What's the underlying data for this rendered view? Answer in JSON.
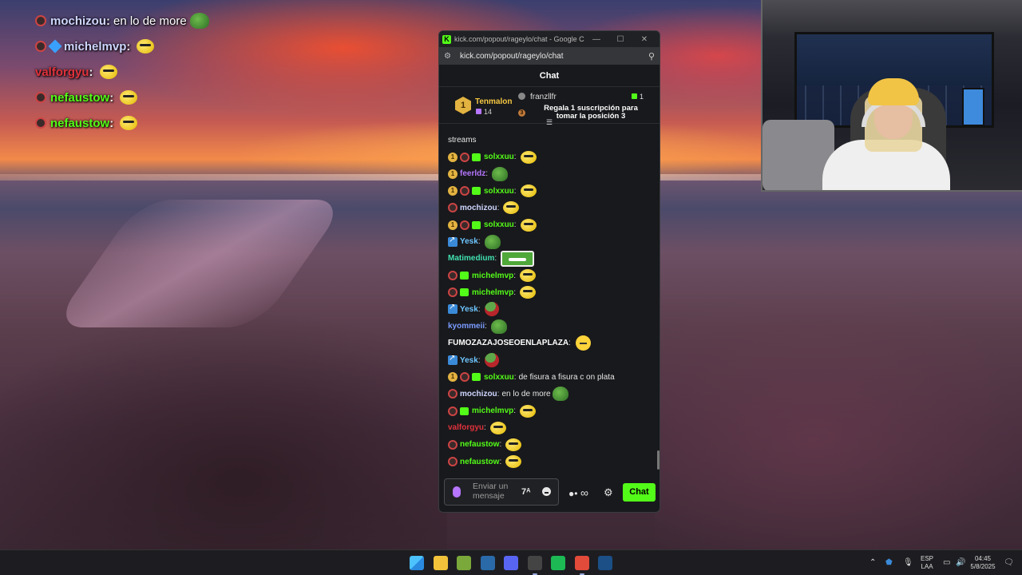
{
  "overlay_chat": [
    {
      "user": "mochizou",
      "color": "#cfd6ff",
      "badges": [
        "mod"
      ],
      "text": "en lo de more",
      "emote": "frog"
    },
    {
      "user": "michelmvp",
      "color": "#cfd6ff",
      "badges": [
        "mod",
        "cube"
      ],
      "text": "",
      "emote": "face"
    },
    {
      "user": "valforgyu",
      "color": "#e0323c",
      "badges": [],
      "text": "",
      "emote": "face"
    },
    {
      "user": "nefaustow",
      "color": "#53fc18",
      "badges": [
        "mod"
      ],
      "text": "",
      "emote": "face"
    },
    {
      "user": "nefaustow",
      "color": "#53fc18",
      "badges": [
        "mod"
      ],
      "text": "",
      "emote": "face"
    }
  ],
  "browser": {
    "title": "kick.com/popout/rageylo/chat - Google Chro...",
    "url": "kick.com/popout/rageylo/chat"
  },
  "chat": {
    "header": "Chat",
    "leaderboard": {
      "first_rank": "1",
      "first_name": "Tenmalon",
      "first_count": "14",
      "second_name": "franzllfr",
      "second_count": "1",
      "third_rank": "3",
      "promo": "Regala 1 suscripción para tomar la posición 3"
    },
    "messages": [
      {
        "badges": [],
        "user": "",
        "color": "#e6e6e6",
        "text": "streams",
        "emote": ""
      },
      {
        "badges": [
          "gold",
          "mod",
          "sub"
        ],
        "user": "solxxuu",
        "color": "#53fc18",
        "text": "",
        "emote": "face"
      },
      {
        "badges": [
          "gold"
        ],
        "user": "feerldz",
        "color": "#b676ff",
        "text": "",
        "emote": "frog"
      },
      {
        "badges": [
          "gold",
          "mod",
          "sub"
        ],
        "user": "solxxuu",
        "color": "#53fc18",
        "text": "",
        "emote": "face"
      },
      {
        "badges": [
          "mod"
        ],
        "user": "mochizou",
        "color": "#cfd6ff",
        "text": "",
        "emote": "face"
      },
      {
        "badges": [
          "gold",
          "mod",
          "sub"
        ],
        "user": "solxxuu",
        "color": "#53fc18",
        "text": "",
        "emote": "face"
      },
      {
        "badges": [
          "arrow"
        ],
        "user": "Yesk",
        "color": "#6ec6ff",
        "text": "",
        "emote": "frog"
      },
      {
        "badges": [],
        "user": "Matimedium",
        "color": "#40e0b0",
        "text": "",
        "emote": "big"
      },
      {
        "badges": [
          "mod",
          "sub"
        ],
        "user": "michelmvp",
        "color": "#53fc18",
        "text": "",
        "emote": "face"
      },
      {
        "badges": [
          "mod",
          "sub"
        ],
        "user": "michelmvp",
        "color": "#53fc18",
        "text": "",
        "emote": "face"
      },
      {
        "badges": [
          "arrow"
        ],
        "user": "Yesk",
        "color": "#6ec6ff",
        "text": "",
        "emote": "frog-red"
      },
      {
        "badges": [],
        "user": "kyommeii",
        "color": "#7a9cff",
        "text": "",
        "emote": "frog"
      },
      {
        "badges": [],
        "user": "FUMOZAZAJOSEOENLAPLAZA",
        "color": "#ffffff",
        "text": "",
        "emote": "round"
      },
      {
        "badges": [
          "arrow"
        ],
        "user": "Yesk",
        "color": "#6ec6ff",
        "text": "",
        "emote": "frog-red"
      },
      {
        "badges": [
          "gold",
          "mod",
          "sub"
        ],
        "user": "solxxuu",
        "color": "#53fc18",
        "text": "de fisura a fisura c on plata",
        "emote": ""
      },
      {
        "badges": [
          "mod"
        ],
        "user": "mochizou",
        "color": "#cfd6ff",
        "text": "en lo de more",
        "emote": "frog"
      },
      {
        "badges": [
          "mod",
          "sub"
        ],
        "user": "michelmvp",
        "color": "#53fc18",
        "text": "",
        "emote": "face"
      },
      {
        "badges": [],
        "user": "valforgyu",
        "color": "#e0323c",
        "text": "",
        "emote": "face"
      },
      {
        "badges": [
          "mod"
        ],
        "user": "nefaustow",
        "color": "#53fc18",
        "text": "",
        "emote": "face"
      },
      {
        "badges": [
          "mod"
        ],
        "user": "nefaustow",
        "color": "#53fc18",
        "text": "",
        "emote": "face"
      }
    ],
    "composer_placeholder": "Enviar un mensaje",
    "send_label": "Chat"
  },
  "taskbar": {
    "apps": [
      {
        "name": "windows-start-icon",
        "color": "#3aa0ff"
      },
      {
        "name": "file-explorer-icon",
        "color": "#f2c23a"
      },
      {
        "name": "app-green-icon",
        "color": "#7aa83a"
      },
      {
        "name": "steam-icon",
        "color": "#2a6aa8"
      },
      {
        "name": "discord-icon",
        "color": "#5865f2"
      },
      {
        "name": "obs-icon",
        "color": "#444444"
      },
      {
        "name": "spotify-icon",
        "color": "#1db954"
      },
      {
        "name": "chrome-icon",
        "color": "#e24a3a"
      },
      {
        "name": "steam-alt-icon",
        "color": "#1b4f86"
      }
    ],
    "lang_top": "ESP",
    "lang_bottom": "LAA",
    "time": "04:45",
    "date": "5/8/2025"
  }
}
